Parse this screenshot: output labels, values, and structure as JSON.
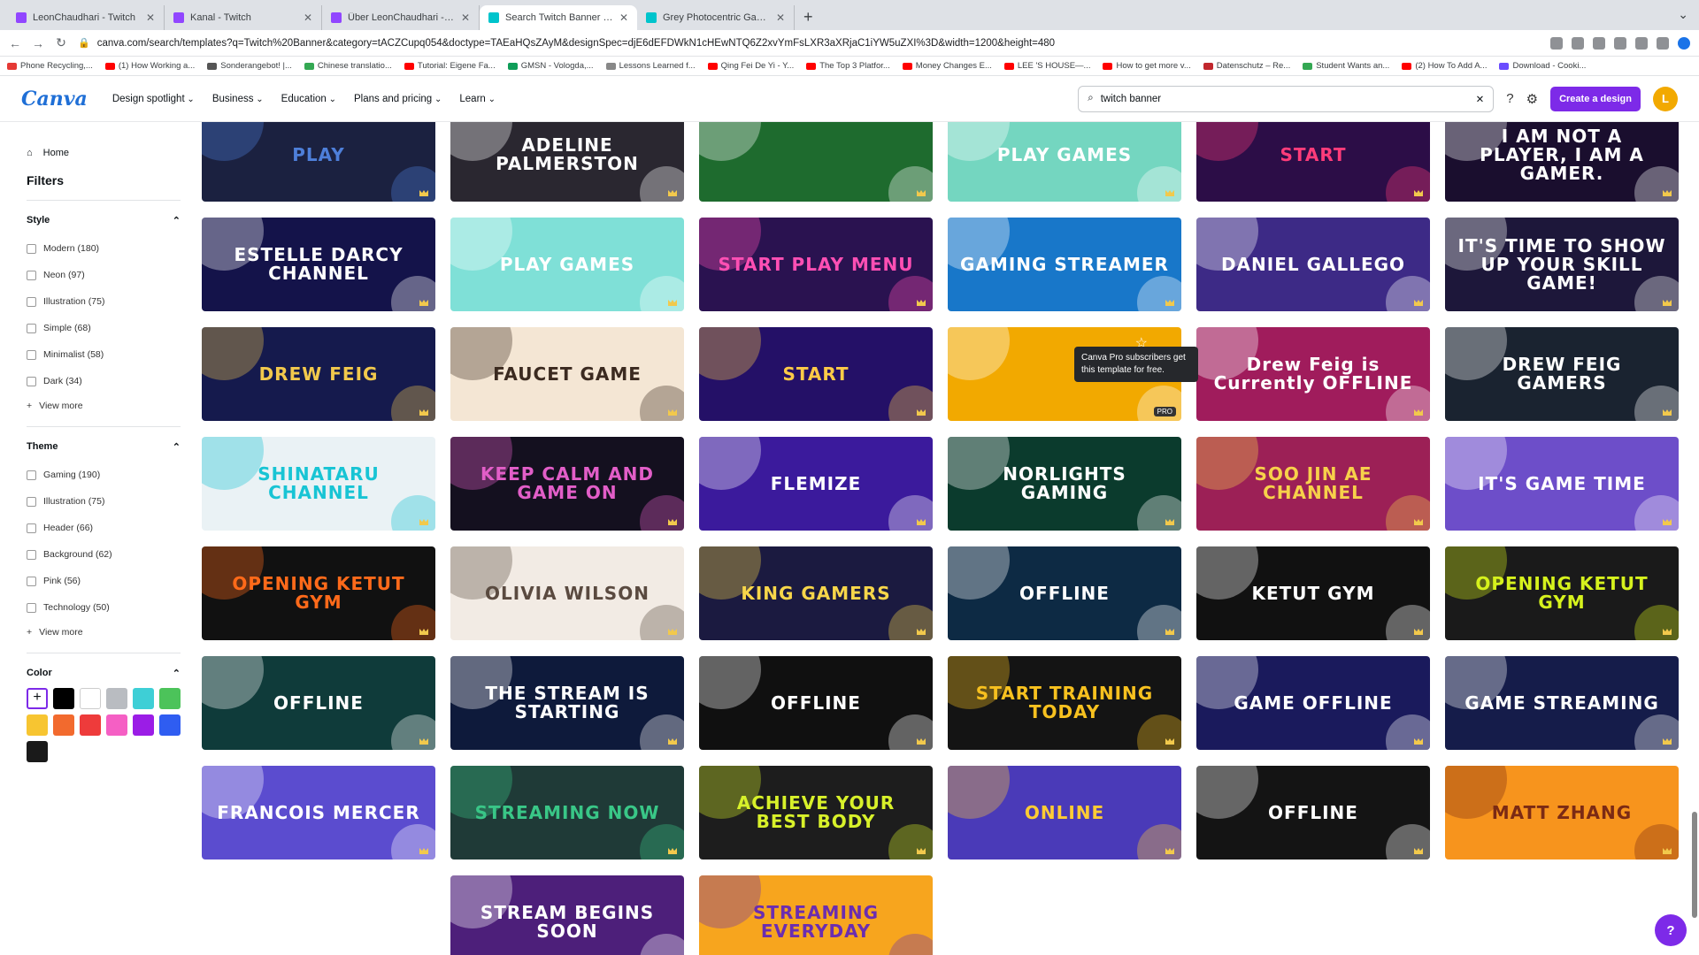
{
  "tabs": [
    {
      "title": "LeonChaudhari - Twitch",
      "color": "#9146ff"
    },
    {
      "title": "Kanal - Twitch",
      "color": "#9146ff"
    },
    {
      "title": "Über LeonChaudhari - Twitch",
      "color": "#9146ff"
    },
    {
      "title": "Search Twitch Banner - Canva",
      "color": "#00c4cc"
    },
    {
      "title": "Grey Photocentric Game Nigh...",
      "color": "#00c4cc"
    }
  ],
  "address": "canva.com/search/templates?q=Twitch%20Banner&category=tACZCupq054&doctype=TAEaHQsZAyM&designSpec=djE6dEFDWkN1cHEwNTQ6Z2xvYmFsLXR3aXRjaC1iYW5uZXI%3D&width=1200&height=480",
  "bookmarks": [
    "Phone Recycling,...",
    "(1) How Working a...",
    "Sonderangebot! |...",
    "Chinese translatio...",
    "Tutorial: Eigene Fa...",
    "GMSN - Vologda,...",
    "Lessons Learned f...",
    "Qing Fei De Yi - Y...",
    "The Top 3 Platfor...",
    "Money Changes E...",
    "LEE 'S HOUSE—...",
    "How to get more v...",
    "Datenschutz – Re...",
    "Student Wants an...",
    "(2) How To Add A...",
    "Download - Cooki..."
  ],
  "header": {
    "logo": "Canva",
    "nav": [
      "Design spotlight",
      "Business",
      "Education",
      "Plans and pricing",
      "Learn"
    ],
    "search_value": "twitch banner",
    "create_label": "Create a design",
    "avatar_letter": "L"
  },
  "sidebar": {
    "home": "Home",
    "filters": "Filters",
    "style_title": "Style",
    "style": [
      "Modern (180)",
      "Neon (97)",
      "Illustration (75)",
      "Simple (68)",
      "Minimalist (58)",
      "Dark (34)"
    ],
    "theme_title": "Theme",
    "theme": [
      "Gaming (190)",
      "Illustration (75)",
      "Header (66)",
      "Background (62)",
      "Pink (56)",
      "Technology (50)"
    ],
    "view_more": "View more",
    "color_title": "Color",
    "colors": [
      "#ffffff",
      "#000000",
      "#ffffff",
      "#b9bcc1",
      "#3ecfd6",
      "#4cc35a",
      "#f7c531",
      "#f26a2e",
      "#ee3b3b",
      "#f55fc4",
      "#9b1de6",
      "#2f5df1",
      "#1a1a1a"
    ]
  },
  "columns": [
    [
      {
        "title": "PLAY",
        "bg": "#1b2140",
        "fg": "#4e7fd9"
      },
      {
        "title": "ESTELLE DARCY CHANNEL",
        "bg": "#14134a",
        "fg": "#ffffff"
      },
      {
        "title": "DREW FEIG",
        "bg": "#151a4d",
        "fg": "#f2c94c"
      },
      {
        "title": "SHINATARU CHANNEL",
        "bg": "#eaf2f5",
        "fg": "#18c4d4"
      },
      {
        "title": "OPENING KETUT GYM",
        "bg": "#111111",
        "fg": "#ff6a1a"
      },
      {
        "title": "OFFLINE",
        "bg": "#0f3b3a",
        "fg": "#ffffff"
      },
      {
        "title": "FRANCOIS MERCER",
        "bg": "#5b4ccf",
        "fg": "#ffffff"
      }
    ],
    [
      {
        "title": "ADELINE PALMERSTON",
        "bg": "#2a2730",
        "fg": "#ffffff"
      },
      {
        "title": "PLAY GAMES",
        "bg": "#7fe0d7",
        "fg": "#ffffff"
      },
      {
        "title": "FAUCET GAME",
        "bg": "#f4e6d4",
        "fg": "#3b2a20"
      },
      {
        "title": "KEEP CALM AND GAME ON",
        "bg": "#14101f",
        "fg": "#e25ec8"
      },
      {
        "title": "OLIVIA WILSON",
        "bg": "#f2ebe4",
        "fg": "#5a4a40"
      },
      {
        "title": "THE STREAM IS STARTING",
        "bg": "#0e1a3b",
        "fg": "#ffffff"
      },
      {
        "title": "STREAMING NOW",
        "bg": "#1f3a37",
        "fg": "#39c787"
      },
      {
        "title": "STREAM BEGINS SOON",
        "bg": "#4d1f7a",
        "fg": "#ffffff"
      }
    ],
    [
      {
        "title": "",
        "bg": "#1e6b2e",
        "fg": "#ffffff"
      },
      {
        "title": "START PLAY MENU",
        "bg": "#2a1250",
        "fg": "#ff4fb4"
      },
      {
        "title": "START",
        "bg": "#241067",
        "fg": "#ffcb47"
      },
      {
        "title": "FLEMIZE",
        "bg": "#3b1a9c",
        "fg": "#ffffff"
      },
      {
        "title": "KING GAMERS",
        "bg": "#1b1a40",
        "fg": "#f7d64a"
      },
      {
        "title": "OFFLINE",
        "bg": "#101010",
        "fg": "#ffffff"
      },
      {
        "title": "ACHIEVE YOUR BEST BODY",
        "bg": "#1d1d1d",
        "fg": "#d8f12a"
      },
      {
        "title": "STREAMING EVERYDAY",
        "bg": "#f7a51e",
        "fg": "#6b2db0"
      }
    ],
    [
      {
        "title": "PLAY GAMES",
        "bg": "#74d6c0",
        "fg": "#ffffff"
      },
      {
        "title": "GAMING STREAMER",
        "bg": "#1877c9",
        "fg": "#ffffff"
      },
      {
        "title": "",
        "bg": "#f2a900",
        "fg": "#ffffff"
      },
      {
        "title": "NORLIGHTS GAMING",
        "bg": "#0b3b2d",
        "fg": "#ffffff"
      },
      {
        "title": "OFFLINE",
        "bg": "#0d2a44",
        "fg": "#ffffff"
      },
      {
        "title": "START TRAINING TODAY",
        "bg": "#141414",
        "fg": "#f7c11f"
      },
      {
        "title": "ONLINE",
        "bg": "#4a3ab8",
        "fg": "#ffcc33"
      }
    ],
    [
      {
        "title": "START",
        "bg": "#2c0d47",
        "fg": "#ff3c7a"
      },
      {
        "title": "DANIEL GALLEGO",
        "bg": "#3d2a86",
        "fg": "#ffffff"
      },
      {
        "title": "Drew Feig is Currently OFFLINE",
        "bg": "#a01c5c",
        "fg": "#ffffff"
      },
      {
        "title": "SOO JIN AE CHANNEL",
        "bg": "#9c2056",
        "fg": "#f7d14a"
      },
      {
        "title": "KETUT GYM",
        "bg": "#111111",
        "fg": "#ffffff"
      },
      {
        "title": "GAME OFFLINE",
        "bg": "#1a1a5c",
        "fg": "#ffffff"
      },
      {
        "title": "OFFLINE",
        "bg": "#141414",
        "fg": "#ffffff"
      }
    ],
    [
      {
        "title": "I AM NOT A PLAYER, I AM A GAMER.",
        "bg": "#1a0e2e",
        "fg": "#ffffff"
      },
      {
        "title": "IT'S TIME TO SHOW UP YOUR SKILL GAME!",
        "bg": "#1d173a",
        "fg": "#ffffff"
      },
      {
        "title": "DREW FEIG GAMERS",
        "bg": "#1a2330",
        "fg": "#ffffff"
      },
      {
        "title": "IT'S GAME TIME",
        "bg": "#6d4ec9",
        "fg": "#ffffff"
      },
      {
        "title": "OPENING KETUT GYM",
        "bg": "#1a1a1a",
        "fg": "#d6f21d"
      },
      {
        "title": "GAME STREAMING",
        "bg": "#151c4a",
        "fg": "#ffffff"
      },
      {
        "title": "MATT ZHANG",
        "bg": "#f7941d",
        "fg": "#7b2a14"
      }
    ]
  ],
  "tooltip": "Canva Pro subscribers get this template for free.",
  "pro_badge": "PRO",
  "help_label": "?"
}
